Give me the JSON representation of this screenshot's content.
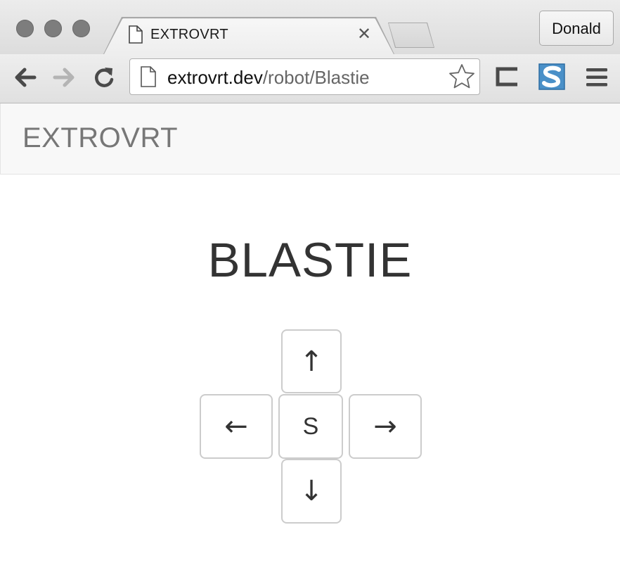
{
  "window": {
    "tab_title": "EXTROVRT",
    "tab_close_symbol": "✕",
    "profile_name": "Donald"
  },
  "address_bar": {
    "host": "extrovrt.dev",
    "path": "/robot/Blastie"
  },
  "toolbar_icons": [
    "back-arrow-icon",
    "forward-arrow-icon",
    "reload-icon",
    "bookmark-star-icon",
    "extension-icon",
    "s-extension-icon",
    "menu-icon"
  ],
  "navbar": {
    "brand": "EXTROVRT"
  },
  "main": {
    "robot_name": "BLASTIE",
    "controls": {
      "up": "↑",
      "left": "←",
      "stop": "S",
      "right": "→",
      "down": "↓"
    }
  },
  "colors": {
    "title_text": "#333333",
    "brand_text": "#777777",
    "key_border": "#cccccc",
    "navbar_bg": "#f8f8f8"
  }
}
